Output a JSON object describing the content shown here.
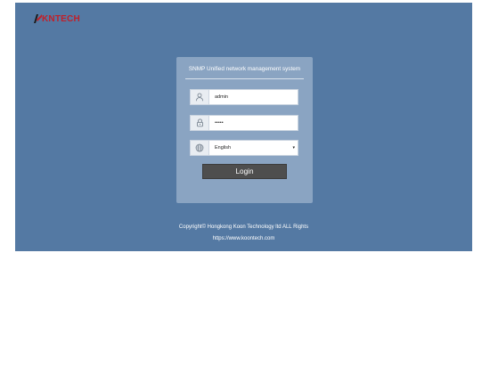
{
  "brand": {
    "logo_text": "KNTECH",
    "logo_color": "#c0202a"
  },
  "login_panel": {
    "title": "SNMP Unified network management system",
    "username": {
      "icon": "user-icon",
      "value": "admin"
    },
    "password": {
      "icon": "lock-icon",
      "value": "•••••"
    },
    "language": {
      "icon": "globe-icon",
      "selected": "English"
    },
    "login_button": "Login"
  },
  "footer": {
    "copyright": "Copyright© Hongkong Koon Technology ltd ALL Rights",
    "url": "https://www.koontech.com"
  },
  "colors": {
    "background": "#5479a3",
    "panel": "#8aa4c2",
    "button": "#4e4e4e"
  }
}
